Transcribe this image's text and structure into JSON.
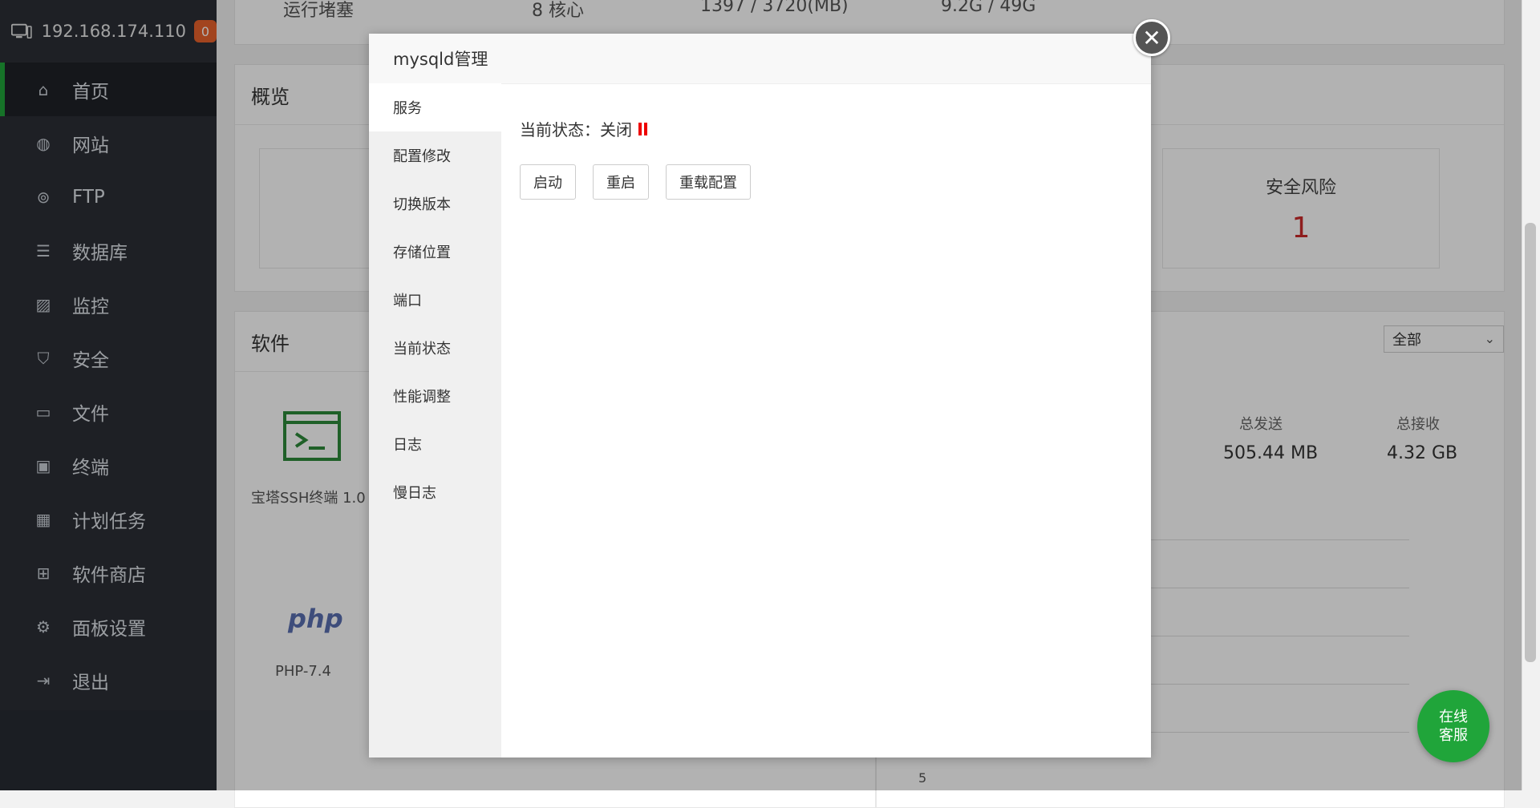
{
  "sidebar": {
    "ip": "192.168.174.110",
    "badge": "0",
    "items": [
      {
        "label": "首页",
        "icon": "home-icon",
        "active": true
      },
      {
        "label": "网站",
        "icon": "globe-icon"
      },
      {
        "label": "FTP",
        "icon": "ftp-icon"
      },
      {
        "label": "数据库",
        "icon": "database-icon"
      },
      {
        "label": "监控",
        "icon": "monitor-icon"
      },
      {
        "label": "安全",
        "icon": "shield-icon"
      },
      {
        "label": "文件",
        "icon": "folder-icon"
      },
      {
        "label": "终端",
        "icon": "terminal-icon"
      },
      {
        "label": "计划任务",
        "icon": "calendar-icon"
      },
      {
        "label": "软件商店",
        "icon": "grid-icon"
      },
      {
        "label": "面板设置",
        "icon": "gear-icon"
      },
      {
        "label": "退出",
        "icon": "exit-icon"
      }
    ]
  },
  "background": {
    "top_row": {
      "label": "运行堵塞",
      "cores": "8 核心",
      "mem": "1397 / 3720(MB)",
      "disk": "9.2G / 49G"
    },
    "overview": {
      "title": "概览",
      "security_label": "安全风险",
      "security_value": "1"
    },
    "software": {
      "title": "软件",
      "filter": "全部",
      "items": [
        {
          "name": "宝塔SSH终端 1.0"
        },
        {
          "name": "PHP-7.4"
        }
      ]
    },
    "traffic": {
      "sent_label": "总发送",
      "sent_value": "505.44 MB",
      "recv_label": "总接收",
      "recv_value": "4.32 GB",
      "axis_tick": "5"
    }
  },
  "modal": {
    "title": "mysqld管理",
    "tabs": [
      "服务",
      "配置修改",
      "切换版本",
      "存储位置",
      "端口",
      "当前状态",
      "性能调整",
      "日志",
      "慢日志"
    ],
    "active_tab": 0,
    "status_label": "当前状态：",
    "status_value": "关闭",
    "buttons": {
      "start": "启动",
      "restart": "重启",
      "reload": "重载配置"
    }
  },
  "chat": {
    "line1": "在线",
    "line2": "客服"
  },
  "colors": {
    "accent": "#20a53a",
    "danger": "#e00000",
    "badge": "#e9622b"
  }
}
